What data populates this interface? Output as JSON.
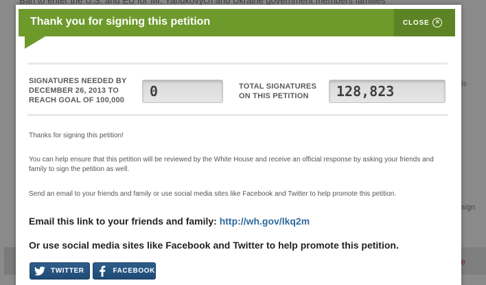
{
  "background": {
    "top_text": "Ban to enter the U.S. and EU for Mr. Yanukovych and Ukraine government members families",
    "side_text_1": "is",
    "side_text_2": "sign",
    "bottom_right_text": "e"
  },
  "modal": {
    "title": "Thank you for signing this petition",
    "close_label": "CLOSE",
    "close_icon": "x-circle-icon"
  },
  "stats": {
    "needed_label": "SIGNATURES NEEDED BY DECEMBER 26, 2013 TO REACH GOAL OF 100,000",
    "needed_value": "0",
    "total_label": "TOTAL SIGNATURES ON THIS PETITION",
    "total_value": "128,823"
  },
  "body": {
    "thanks": "Thanks for signing this petition!",
    "help": "You can help ensure that this petition will be reviewed by the White House and receive an official response by asking your friends and family to sign the petition as well.",
    "send": "Send an email to your friends and family or use social media sites like Facebook and Twitter to help promote this petition.",
    "email_prefix": "Email this link to your friends and family:",
    "email_link": "http://wh.gov/lkq2m",
    "social": "Or use social media sites like Facebook and Twitter to help promote this petition."
  },
  "buttons": {
    "twitter": "TWITTER",
    "facebook": "FACEBOOK"
  },
  "colors": {
    "header_green": "#6e9a2c",
    "link_blue": "#2e6a9c",
    "button_blue": "#2e5d8a"
  }
}
